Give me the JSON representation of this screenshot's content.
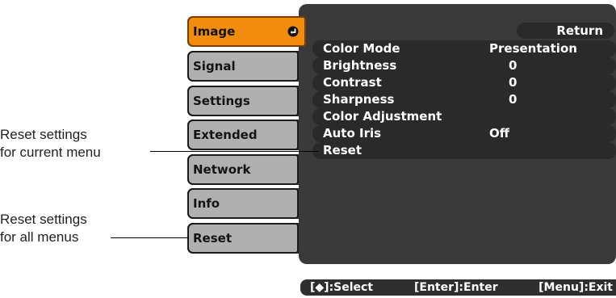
{
  "callouts": {
    "current_line1": "Reset settings",
    "current_line2": "for current menu",
    "all_line1": "Reset settings",
    "all_line2": "for all menus"
  },
  "tabs": [
    {
      "label": "Image",
      "active": true
    },
    {
      "label": "Signal"
    },
    {
      "label": "Settings"
    },
    {
      "label": "Extended"
    },
    {
      "label": "Network"
    },
    {
      "label": "Info"
    },
    {
      "label": "Reset"
    }
  ],
  "panel": {
    "return_label": "Return",
    "items": [
      {
        "label": "Color Mode",
        "value": "Presentation"
      },
      {
        "label": "Brightness",
        "value": "0"
      },
      {
        "label": "Contrast",
        "value": "0"
      },
      {
        "label": "Sharpness",
        "value": "0"
      },
      {
        "label": "Color Adjustment",
        "value": ""
      },
      {
        "label": "Auto Iris",
        "value": "Off"
      },
      {
        "label": "Reset",
        "value": ""
      }
    ]
  },
  "footer": {
    "select_hint": "[◆]:Select",
    "enter_hint": "[Enter]:Enter",
    "exit_hint": "[Menu]:Exit"
  },
  "colors": {
    "active_tab": "#f28c0c",
    "tab": "#b0b0b0",
    "panel": "#3a3a3a",
    "footer": "#2e2e2e"
  },
  "icons": {
    "active_tab_icon": "enter-icon"
  }
}
